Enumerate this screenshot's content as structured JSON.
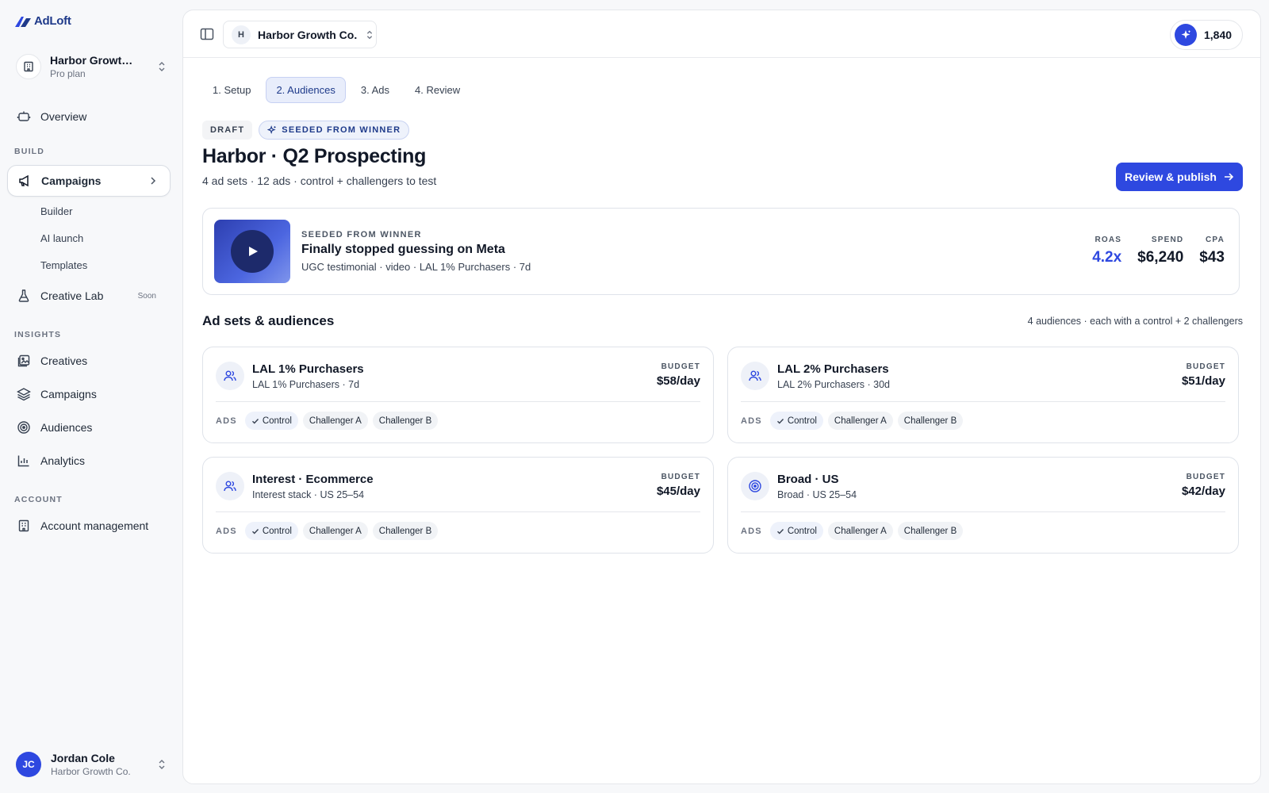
{
  "app": {
    "logo_text": "AdLoft"
  },
  "org": {
    "name": "Harbor Growth Co.",
    "plan": "Pro plan"
  },
  "nav": {
    "overview": "Overview",
    "build_label": "BUILD",
    "campaigns": "Campaigns",
    "builder": "Builder",
    "ai_launch": "AI launch",
    "templates": "Templates",
    "creative_lab": "Creative Lab",
    "soon": "Soon",
    "insights_label": "INSIGHTS",
    "creatives": "Creatives",
    "insights_campaigns": "Campaigns",
    "audiences": "Audiences",
    "analytics": "Analytics",
    "account_label": "ACCOUNT",
    "account_management": "Account management"
  },
  "user": {
    "initials": "JC",
    "name": "Jordan Cole",
    "org": "Harbor Growth Co."
  },
  "topbar": {
    "workspace_initial": "H",
    "workspace_name": "Harbor Growth Co.",
    "credits": "1,840"
  },
  "steps": [
    "1. Setup",
    "2. Audiences",
    "3. Ads",
    "4. Review"
  ],
  "active_step": 1,
  "tags": {
    "draft": "DRAFT",
    "seeded": "SEEDED FROM WINNER"
  },
  "campaign": {
    "title": "Harbor · Q2 Prospecting",
    "subtitle": "4 ad sets · 12 ads · control + challengers to test",
    "publish_label": "Review & publish"
  },
  "winner": {
    "label": "SEEDED FROM WINNER",
    "title": "Finally stopped guessing on Meta",
    "meta": "UGC testimonial · video · LAL 1% Purchasers · 7d",
    "metrics": [
      {
        "label": "ROAS",
        "value": "4.2x",
        "color": "#2e48e0"
      },
      {
        "label": "SPEND",
        "value": "$6,240"
      },
      {
        "label": "CPA",
        "value": "$43"
      }
    ]
  },
  "adsets": {
    "title": "Ad sets & audiences",
    "note": "4 audiences · each with a control + 2 challengers",
    "budget_label": "BUDGET",
    "ads_label": "ADS",
    "chips": [
      "Control",
      "Challenger A",
      "Challenger B"
    ],
    "cards": [
      {
        "name": "LAL 1% Purchasers",
        "desc": "LAL 1% Purchasers · 7d",
        "budget": "$58/day",
        "icon": "users-icon"
      },
      {
        "name": "LAL 2% Purchasers",
        "desc": "LAL 2% Purchasers · 30d",
        "budget": "$51/day",
        "icon": "users-icon"
      },
      {
        "name": "Interest · Ecommerce",
        "desc": "Interest stack · US 25–54",
        "budget": "$45/day",
        "icon": "users-icon"
      },
      {
        "name": "Broad · US",
        "desc": "Broad · US 25–54",
        "budget": "$42/day",
        "icon": "target-icon"
      }
    ]
  },
  "colors": {
    "accent": "#2e48e0"
  }
}
